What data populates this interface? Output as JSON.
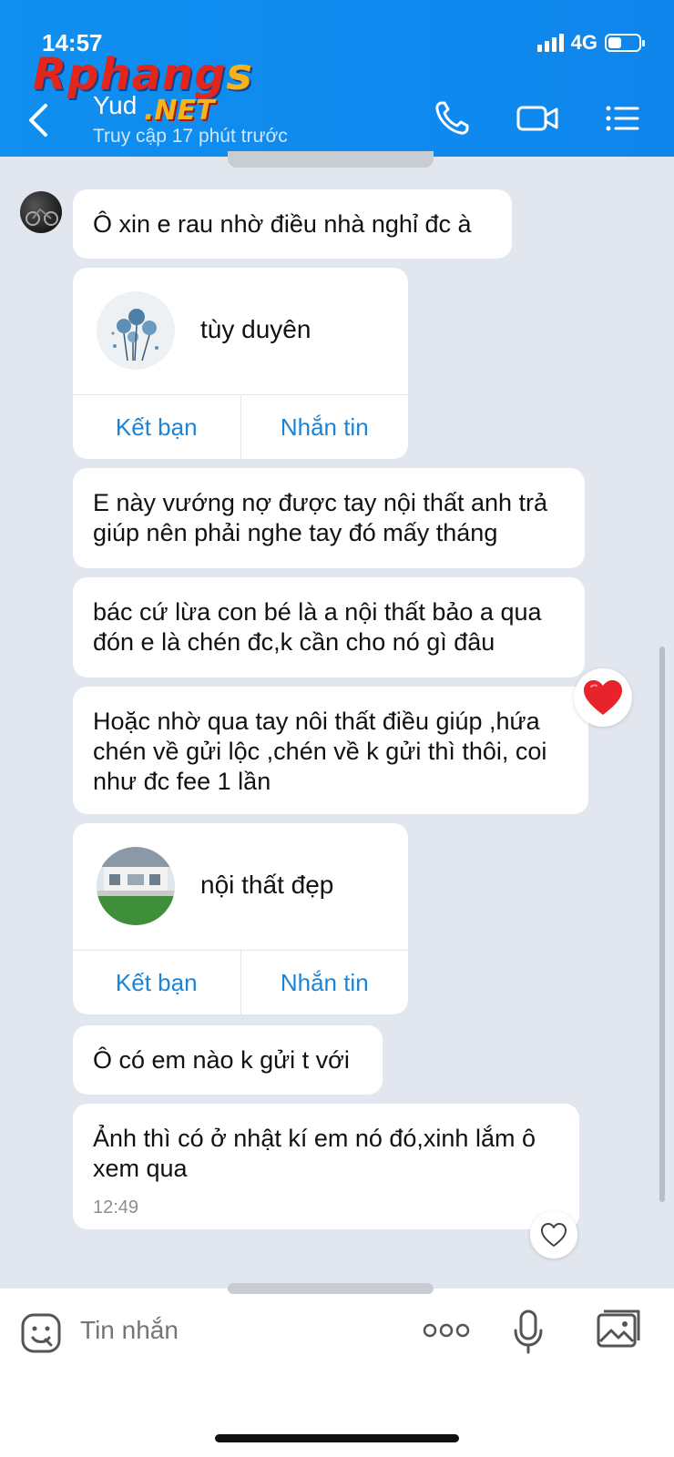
{
  "status": {
    "time": "14:57",
    "network": "4G",
    "battery_level": 0.45
  },
  "watermark": {
    "brand_main": "Rphang",
    "brand_s": "s",
    "brand_net": ".NET"
  },
  "header": {
    "name": "Yud",
    "subtitle": "Truy cập 17 phút trước",
    "icons": [
      "back-icon",
      "phone-icon",
      "video-icon",
      "menu-icon"
    ]
  },
  "messages": [
    {
      "type": "text",
      "text": "Ô xin e rau nhờ điều nhà nghỉ đc à"
    },
    {
      "type": "contact_card",
      "name": "tùy duyên",
      "add_friend": "Kết bạn",
      "message": "Nhắn tin"
    },
    {
      "type": "text",
      "text": "E này vướng nợ được tay nội thất anh trả giúp nên phải nghe tay đó mấy tháng"
    },
    {
      "type": "text",
      "text": "bác cứ lừa con bé là a nội thất bảo a qua đón e là chén đc,k cần cho nó gì đâu"
    },
    {
      "type": "text",
      "text": "Hoặc nhờ qua tay nôi thất điều giúp ,hứa chén về gửi lộc ,chén về k gửi thì thôi, coi như đc fee 1 lần",
      "reaction": "heart"
    },
    {
      "type": "contact_card",
      "name": "nội thất đẹp",
      "add_friend": "Kết bạn",
      "message": "Nhắn tin"
    },
    {
      "type": "text",
      "text": "Ô có em nào k gửi t với"
    },
    {
      "type": "text",
      "text": "Ảnh thì có ở nhật kí em nó đó,xinh lắm ô xem qua",
      "time": "12:49"
    }
  ],
  "input": {
    "placeholder": "Tin nhắn"
  },
  "colors": {
    "header_bg": "#0f8ff0",
    "link": "#1b84d6",
    "chat_bg": "#e2e6ee",
    "heart": "#e8232b"
  }
}
